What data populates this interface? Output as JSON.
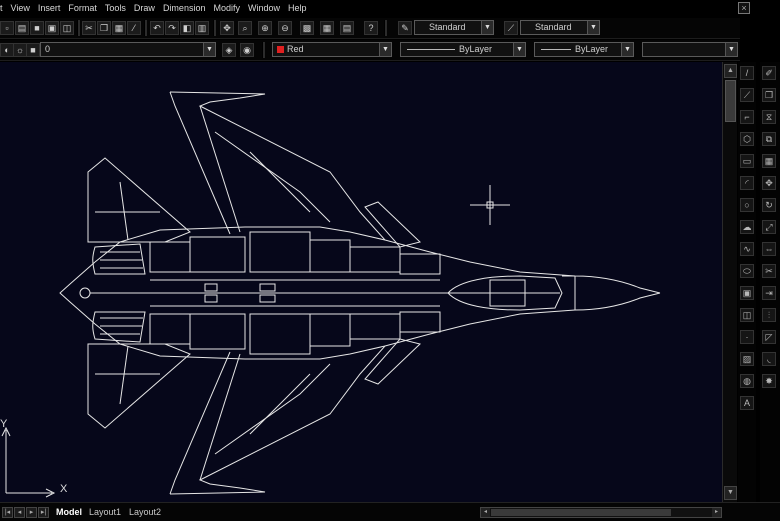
{
  "menu": [
    "t",
    "View",
    "Insert",
    "Format",
    "Tools",
    "Draw",
    "Dimension",
    "Modify",
    "Window",
    "Help"
  ],
  "window_buttons": {
    "close": "×"
  },
  "toolbar": {
    "text_style": "Standard",
    "dim_style": "Standard",
    "layer": "0",
    "color": "Red",
    "linetype": "ByLayer",
    "lineweight": "ByLayer",
    "plot_style": ""
  },
  "colors": {
    "canvas": "#06071a",
    "drawing": "#e6e6e6",
    "layer_color": "#e02020"
  },
  "ucs": {
    "x_label": "X",
    "y_label": "Y"
  },
  "layout_tabs": [
    "Model",
    "Layout1",
    "Layout2"
  ],
  "active_tab": "Model",
  "icons": {
    "toolbar_top": [
      "new-icon",
      "open-icon",
      "save-icon",
      "print-icon",
      "preview-icon",
      "cut-icon",
      "copy-icon",
      "paste-icon",
      "match-prop-icon",
      "undo-icon",
      "redo-icon",
      "pan-icon",
      "zoom-realtime-icon",
      "zoom-window-icon",
      "zoom-previous-icon",
      "properties-icon",
      "design-center-icon",
      "tool-palettes-icon",
      "help-icon"
    ],
    "draw_toolbar": [
      "line-icon",
      "xline-icon",
      "polyline-icon",
      "polygon-icon",
      "rectangle-icon",
      "arc-icon",
      "circle-icon",
      "revcloud-icon",
      "spline-icon",
      "ellipse-icon",
      "insert-block-icon",
      "make-block-icon",
      "point-icon",
      "hatch-icon",
      "region-icon",
      "mtext-icon"
    ],
    "modify_toolbar": [
      "erase-icon",
      "copy-object-icon",
      "mirror-icon",
      "offset-icon",
      "array-icon",
      "move-icon",
      "rotate-icon",
      "scale-icon",
      "stretch-icon",
      "trim-icon",
      "extend-icon",
      "break-icon",
      "chamfer-icon",
      "fillet-icon",
      "explode-icon"
    ]
  }
}
